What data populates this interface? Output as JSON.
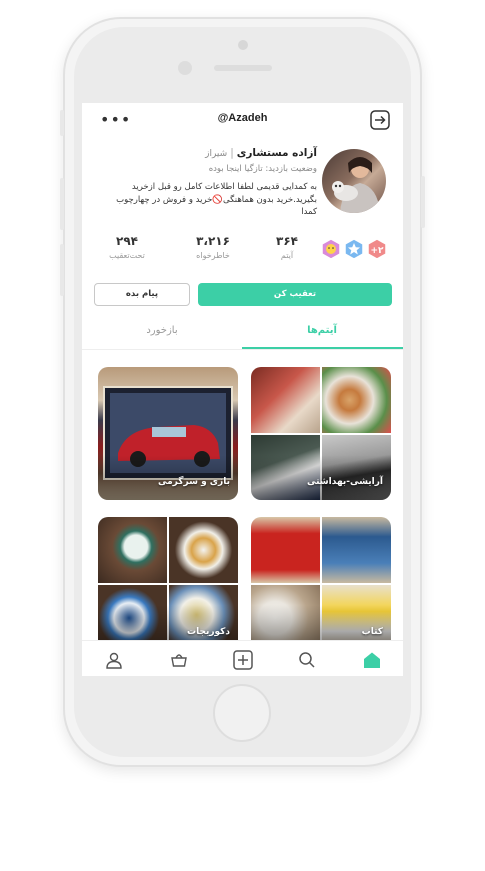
{
  "header": {
    "username": "@Azadeh",
    "more_icon": "more-dots-icon",
    "share_icon": "share-exit-icon"
  },
  "profile": {
    "name": "آزاده مستشاری",
    "separator": "|",
    "city": "شیراز",
    "last_visit": "وضعیت بازدید: تازگیا اینجا بوده",
    "bio": "به کمدایی قدیمی لطفا اطلاعات کامل رو قبل ازخرید بگیرید.خرید بدون هماهنگی🚫خرید و فروش در چهارچوب کمدا"
  },
  "stats": [
    {
      "value": "۳۶۴",
      "label": "آیتم"
    },
    {
      "value": "۳،۲۱۶",
      "label": "خاطرخواه"
    },
    {
      "value": "۲۹۴",
      "label": "تحت‌تعقیب"
    }
  ],
  "badges": [
    "plus-two-badge",
    "star-badge",
    "smile-badge"
  ],
  "buttons": {
    "follow": "تعقیب کن",
    "message": "پیام بده"
  },
  "tabs": {
    "items": "آیتم‌ها",
    "feedback": "بازخورد",
    "active": "items"
  },
  "categories": [
    {
      "label": "آرایشی-بهداشتی"
    },
    {
      "label": "بازی و سرگرمی"
    },
    {
      "label": "کتاب"
    },
    {
      "label": "دکوریجات"
    }
  ],
  "bottom_nav": [
    "home-icon",
    "search-icon",
    "add-icon",
    "basket-icon",
    "profile-icon"
  ],
  "colors": {
    "accent": "#3ccfa6"
  }
}
